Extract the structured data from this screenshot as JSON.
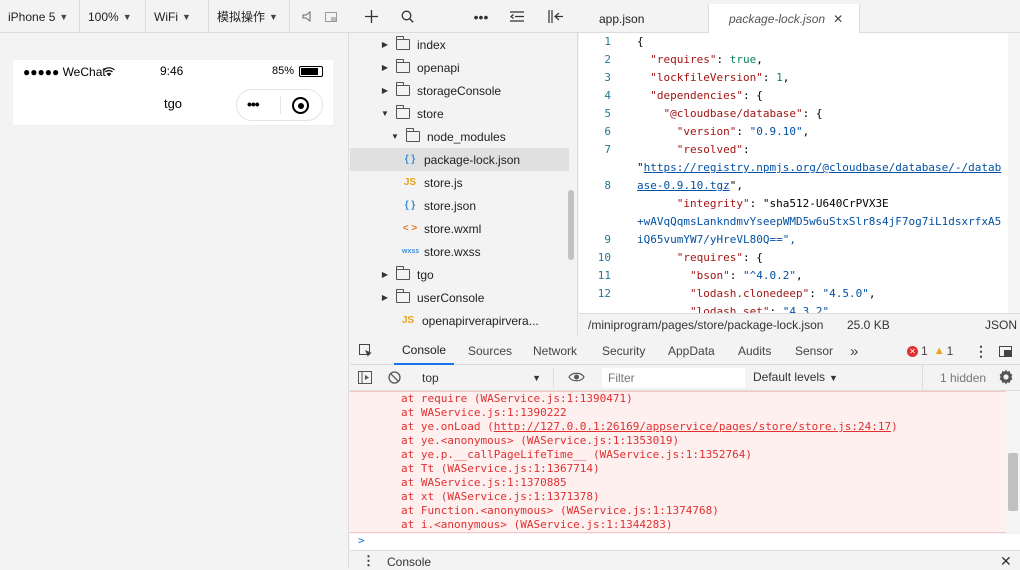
{
  "toolbar": {
    "device": "iPhone 5",
    "zoom": "100%",
    "network": "WiFi",
    "sim_op": "模拟操作"
  },
  "phone": {
    "carrier": "●●●●● WeChat",
    "time": "9:46",
    "battery": "85%",
    "battery_level": 0.85,
    "page_title": "tgo",
    "capsule_more": "•••"
  },
  "tree": {
    "items": [
      {
        "label": "index",
        "type": "folder",
        "state": "collapsed"
      },
      {
        "label": "openapi",
        "type": "folder",
        "state": "collapsed"
      },
      {
        "label": "storageConsole",
        "type": "folder",
        "state": "collapsed"
      },
      {
        "label": "store",
        "type": "folder",
        "state": "expanded"
      },
      {
        "label": "node_modules",
        "type": "folder",
        "state": "expanded"
      },
      {
        "label": "package-lock.json",
        "type": "json",
        "icon": "{ }"
      },
      {
        "label": "store.js",
        "type": "js",
        "icon": "JS"
      },
      {
        "label": "store.json",
        "type": "json",
        "icon": "{ }"
      },
      {
        "label": "store.wxml",
        "type": "wxml",
        "icon": "< >"
      },
      {
        "label": "store.wxss",
        "type": "wxss",
        "icon": "wxss"
      },
      {
        "label": "tgo",
        "type": "folder",
        "state": "collapsed"
      },
      {
        "label": "userConsole",
        "type": "folder",
        "state": "collapsed"
      },
      {
        "label": "openapirverapirvera...",
        "type": "js",
        "icon": "JS"
      }
    ]
  },
  "editor": {
    "tabs": [
      {
        "label": "app.json"
      },
      {
        "label": "package-lock.json",
        "close": "✕"
      }
    ],
    "line_numbers": [
      "1",
      "2",
      "3",
      "4",
      "5",
      "6",
      "7",
      "",
      "8",
      "",
      "",
      "9",
      "10",
      "11",
      "12"
    ],
    "lines": [
      "{",
      "  \"requires\": true,",
      "  \"lockfileVersion\": 1,",
      "  \"dependencies\": {",
      "    \"@cloudbase/database\": {",
      "      \"version\": \"0.9.10\",",
      "      \"resolved\":",
      "\"https://registry.npmjs.org/@cloudbase/database/-/datab",
      "ase-0.9.10.tgz\",",
      "      \"integrity\": \"sha512-U640CrPVX3E",
      "+wAVqQqmsLankndmvYseepWMD5w6uStxSlr8s4jF7og7iL1dsxrfxA5",
      "iQ65vumYW7/yHreVL80Q==\",",
      "      \"requires\": {",
      "        \"bson\": \"^4.0.2\",",
      "        \"lodash.clonedeep\": \"4.5.0\",",
      "        \"lodash.set\": \"4.3.2\""
    ],
    "status_path": "/miniprogram/pages/store/package-lock.json",
    "status_size": "25.0 KB",
    "status_lang": "JSON"
  },
  "devtools": {
    "tabs": [
      "Console",
      "Sources",
      "Network",
      "Security",
      "AppData",
      "Audits",
      "Sensor"
    ],
    "more": "»",
    "errors": "1",
    "warnings": "1",
    "context": "top",
    "filter_placeholder": "Filter",
    "levels": "Default levels",
    "hidden": "1 hidden",
    "console_lines": [
      "at require (WAService.js:1:1390471)",
      "at WAService.js:1:1390222",
      "at ye.onLoad (http://127.0.0.1:26169/appservice/pages/store/store.js:24:17)",
      "at ye.<anonymous> (WAService.js:1:1353019)",
      "at ye.p.__callPageLifeTime__ (WAService.js:1:1352764)",
      "at Tt (WAService.js:1:1367714)",
      "at WAService.js:1:1370885",
      "at xt (WAService.js:1:1371378)",
      "at Function.<anonymous> (WAService.js:1:1374768)",
      "at i.<anonymous> (WAService.js:1:1344283)"
    ],
    "prompt": ">",
    "drawer_label": "Console"
  },
  "colors": {
    "error": "#e03030",
    "console_bg": "#fff0f0",
    "accent": "#1a73e8",
    "js_icon": "#e8a317",
    "json_icon": "#3b8ed8",
    "wxml_icon": "#e37933"
  }
}
